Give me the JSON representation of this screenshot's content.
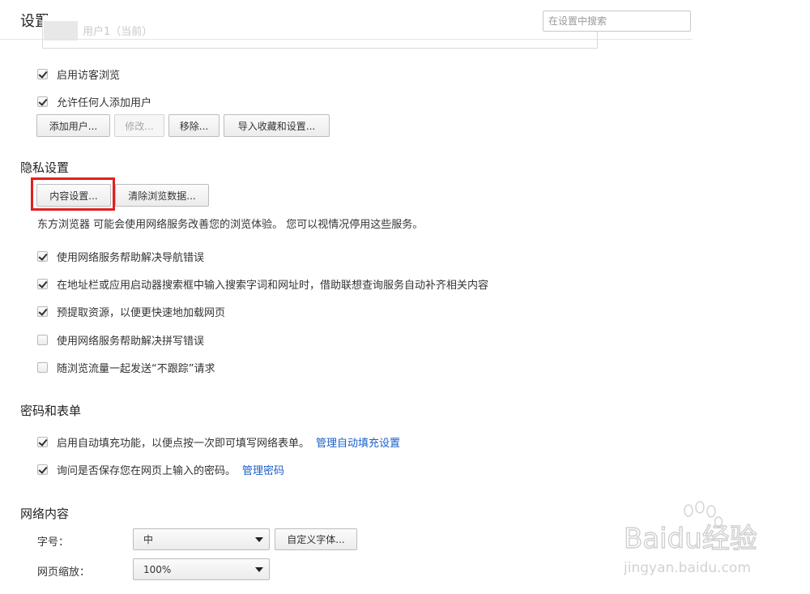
{
  "header": {
    "title": "设置",
    "search_placeholder": "在设置中搜索"
  },
  "users": {
    "current_user": "用户1（当前）",
    "checks": [
      {
        "label": "启用访客浏览",
        "checked": true
      },
      {
        "label": "允许任何人添加用户",
        "checked": true
      }
    ],
    "buttons": {
      "add": "添加用户...",
      "edit": "修改...",
      "remove": "移除...",
      "import": "导入收藏和设置..."
    }
  },
  "privacy": {
    "title": "隐私设置",
    "buttons": {
      "content": "内容设置...",
      "clear": "清除浏览数据..."
    },
    "description": "东方浏览器 可能会使用网络服务改善您的浏览体验。 您可以视情况停用这些服务。",
    "checks": [
      {
        "label": "使用网络服务帮助解决导航错误",
        "checked": true
      },
      {
        "label": "在地址栏或应用启动器搜索框中输入搜索字词和网址时，借助联想查询服务自动补齐相关内容",
        "checked": true
      },
      {
        "label": "预提取资源，以便更快速地加载网页",
        "checked": true
      },
      {
        "label": "使用网络服务帮助解决拼写错误",
        "checked": false
      },
      {
        "label": "随浏览流量一起发送“不跟踪”请求",
        "checked": false
      }
    ]
  },
  "passwords": {
    "title": "密码和表单",
    "autofill_label": "启用自动填充功能，以便点按一次即可填写网络表单。",
    "autofill_link": "管理自动填充设置",
    "save_pw_label": "询问是否保存您在网页上输入的密码。",
    "save_pw_link": "管理密码",
    "autofill_checked": true,
    "save_pw_checked": true
  },
  "web_content": {
    "title": "网络内容",
    "font_size_label": "字号：",
    "font_size_value": "中",
    "custom_font_button": "自定义字体...",
    "zoom_label": "网页缩放：",
    "zoom_value": "100%"
  },
  "watermark": {
    "brand": "Baidu经验",
    "url": "jingyan.baidu.com"
  },
  "colors": {
    "highlight": "#e02020",
    "link": "#1a5fc8"
  }
}
